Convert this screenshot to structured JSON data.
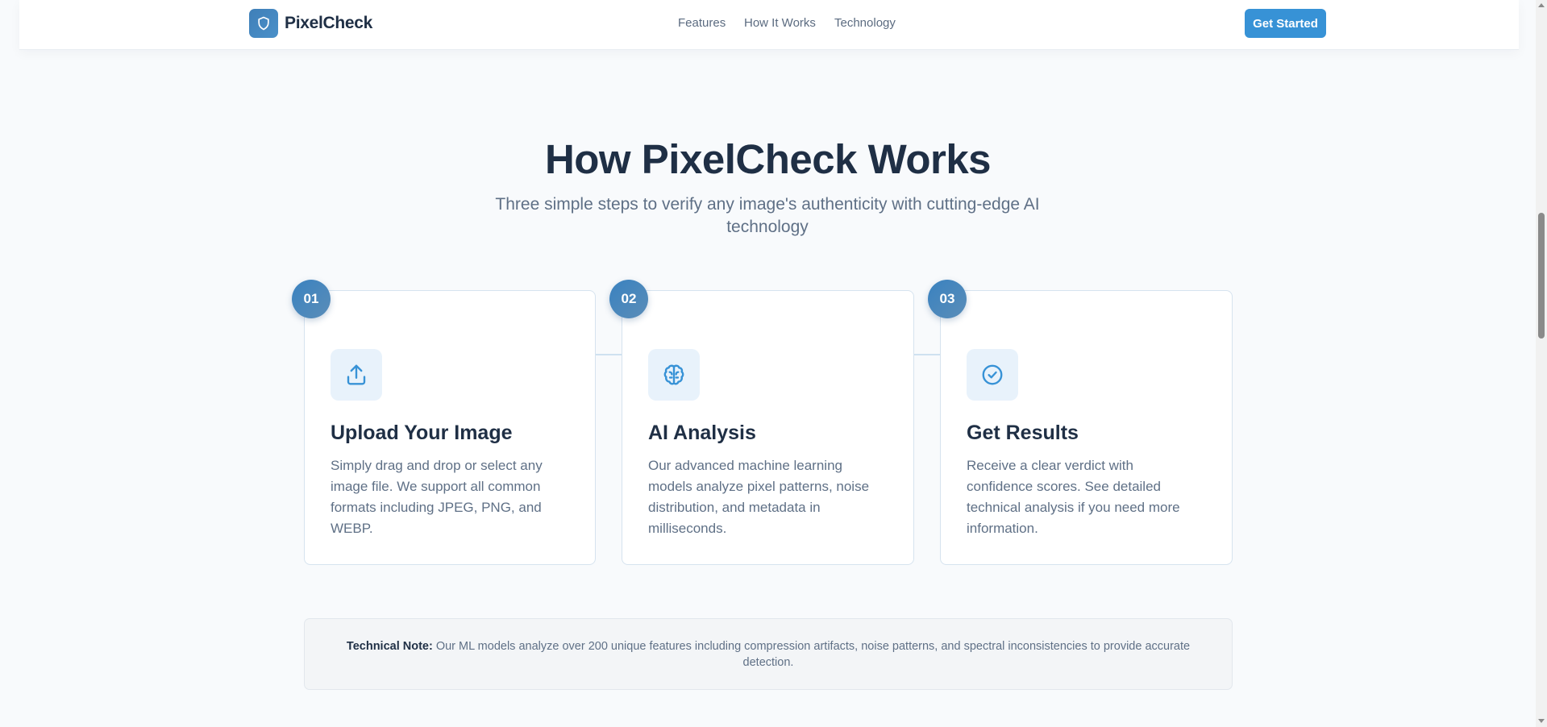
{
  "header": {
    "brand": "PixelCheck",
    "logo_icon": "shield-icon",
    "nav": [
      "Features",
      "How It Works",
      "Technology"
    ],
    "cta_label": "Get Started"
  },
  "hero": {
    "title": "How PixelCheck Works",
    "subtitle": "Three simple steps to verify any image's authenticity with cutting-edge AI technology"
  },
  "steps": [
    {
      "number": "01",
      "icon": "upload-icon",
      "title": "Upload Your Image",
      "description": "Simply drag and drop or select any image file. We support all common formats including JPEG, PNG, and WEBP."
    },
    {
      "number": "02",
      "icon": "brain-icon",
      "title": "AI Analysis",
      "description": "Our advanced machine learning models analyze pixel patterns, noise distribution, and metadata in milliseconds."
    },
    {
      "number": "03",
      "icon": "check-circle-icon",
      "title": "Get Results",
      "description": "Receive a clear verdict with confidence scores. See detailed technical analysis if you need more information."
    }
  ],
  "note": {
    "label": "Technical Note:",
    "text": "Our ML models analyze over 200 unique features including compression artifacts, noise patterns, and spectral inconsistencies to provide accurate detection."
  },
  "colors": {
    "accent": "#3792d6",
    "heading": "#1f2f45",
    "muted": "#5f7086",
    "background": "#f8fafc"
  }
}
